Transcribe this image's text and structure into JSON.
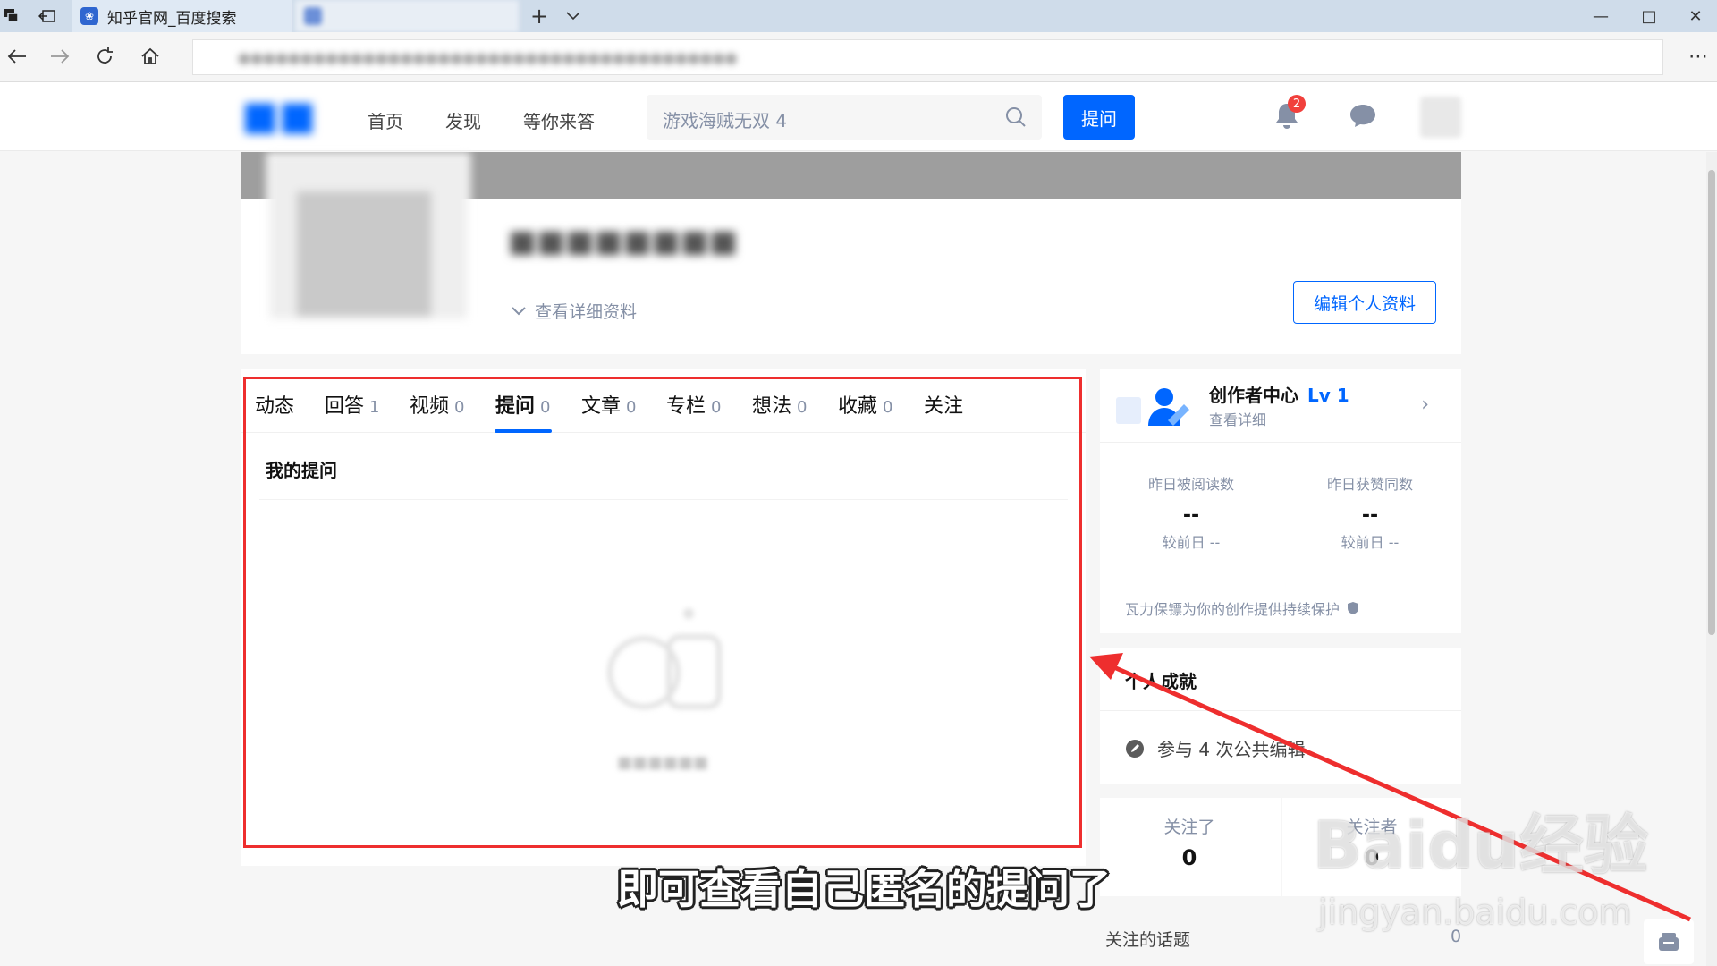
{
  "browser": {
    "active_tab_title": "知乎官网_百度搜索",
    "favicon": "baidu-paw-icon",
    "new_tab_label": "+",
    "window_controls": [
      "—",
      "□",
      "✕"
    ]
  },
  "header": {
    "nav": [
      "首页",
      "发现",
      "等你来答"
    ],
    "search_value": "游戏海贼无双 4",
    "ask_label": "提问",
    "notification_count": "2"
  },
  "profile": {
    "detail_link": "查看详细资料",
    "edit_label": "编辑个人资料"
  },
  "tabs": [
    {
      "label": "动态",
      "count": ""
    },
    {
      "label": "回答",
      "count": "1"
    },
    {
      "label": "视频",
      "count": "0"
    },
    {
      "label": "提问",
      "count": "0"
    },
    {
      "label": "文章",
      "count": "0"
    },
    {
      "label": "专栏",
      "count": "0"
    },
    {
      "label": "想法",
      "count": "0"
    },
    {
      "label": "收藏",
      "count": "0"
    },
    {
      "label": "关注",
      "count": ""
    }
  ],
  "active_tab": "提问",
  "main": {
    "section_title": "我的提问"
  },
  "creator": {
    "title": "创作者中心",
    "level": "Lv 1",
    "subtitle": "查看详细",
    "stats": [
      {
        "label": "昨日被阅读数",
        "value": "--",
        "compare": "较前日 --"
      },
      {
        "label": "昨日获赞同数",
        "value": "--",
        "compare": "较前日 --"
      }
    ],
    "protect_text": "瓦力保镖为你的创作提供持续保护"
  },
  "achievement": {
    "title": "个人成就",
    "item": "参与 4 次公共编辑"
  },
  "follow": {
    "following_label": "关注了",
    "following_value": "0",
    "followers_label": "关注者",
    "followers_value": "0"
  },
  "topics": {
    "label": "关注的话题",
    "count": "0"
  },
  "overlay": {
    "caption": "即可查看自己匿名的提问了",
    "watermark": "Baidu经验",
    "watermark_url": "jingyan.baidu.com"
  },
  "colors": {
    "brand": "#0066ff",
    "highlight_box": "#ee2e2e",
    "badge": "#f1403c"
  }
}
